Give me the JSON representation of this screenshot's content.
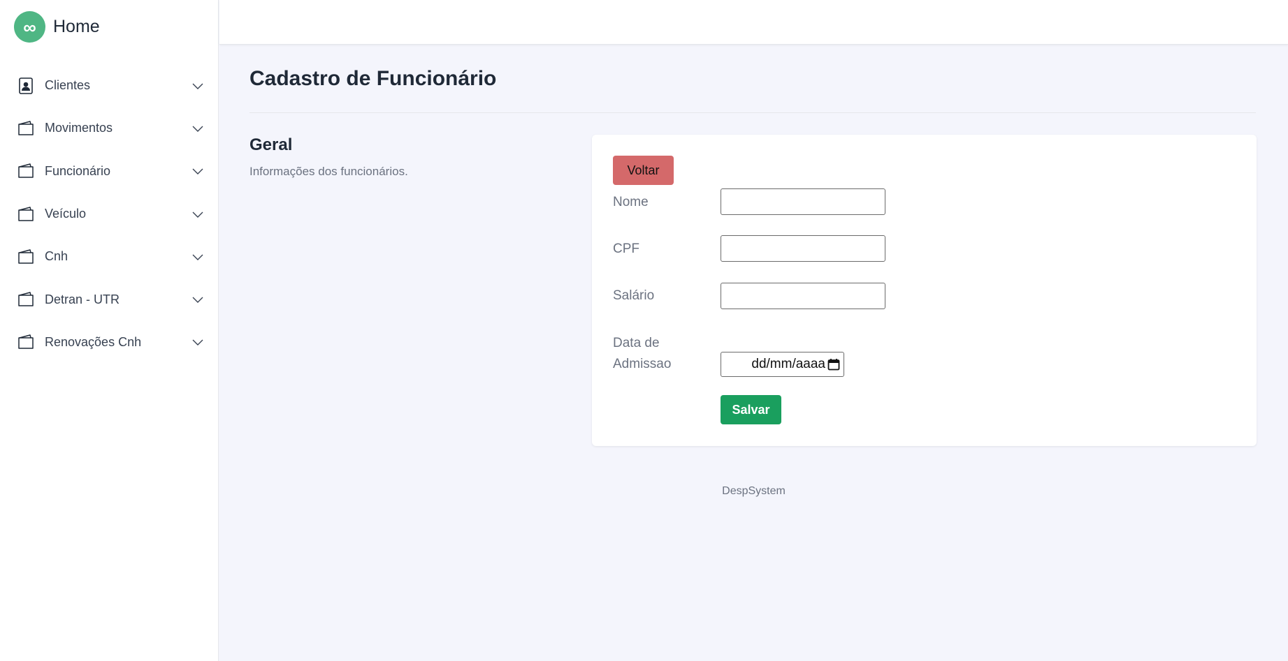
{
  "brand": {
    "logo_symbol": "∞",
    "title": "Home",
    "logo_color": "#4fb684"
  },
  "sidebar": {
    "items": [
      {
        "label": "Clientes",
        "icon": "contact-card-icon"
      },
      {
        "label": "Movimentos",
        "icon": "wallet-icon"
      },
      {
        "label": "Funcionário",
        "icon": "wallet-icon"
      },
      {
        "label": "Veículo",
        "icon": "wallet-icon"
      },
      {
        "label": "Cnh",
        "icon": "wallet-icon"
      },
      {
        "label": "Detran - UTR",
        "icon": "wallet-icon"
      },
      {
        "label": "Renovações Cnh",
        "icon": "wallet-icon"
      }
    ]
  },
  "page": {
    "title": "Cadastro de Funcionário",
    "section_title": "Geral",
    "section_description": "Informações dos funcionários."
  },
  "form": {
    "back_label": "Voltar",
    "back_color": "#d4696a",
    "fields": {
      "nome": {
        "label": "Nome",
        "value": ""
      },
      "cpf": {
        "label": "CPF",
        "value": ""
      },
      "salario": {
        "label": "Salário",
        "value": ""
      },
      "data_admissao": {
        "label_line1": "Data de",
        "label_line2": "Admissao",
        "placeholder": "dd/mm/aaaa"
      }
    },
    "save_label": "Salvar",
    "save_color": "#1a9f5e"
  },
  "footer": {
    "text": "DespSystem"
  }
}
